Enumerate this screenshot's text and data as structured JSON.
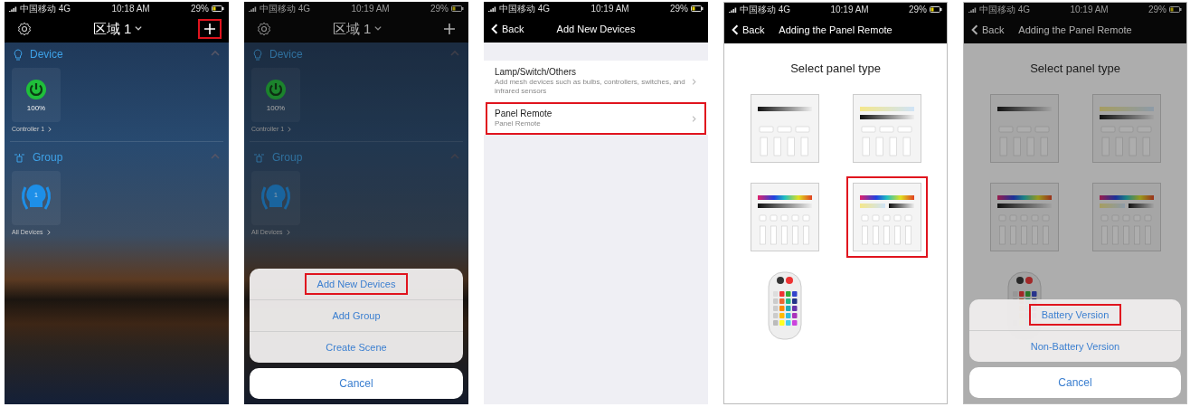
{
  "screens": [
    {
      "kind": "home",
      "status_bar": {
        "carrier": "中国移动 4G",
        "time": "10:18 AM",
        "battery": "29%"
      },
      "title": "区域 1",
      "add_highlighted": true,
      "sections": [
        {
          "kind": "device",
          "label": "Device",
          "expanded": true,
          "tiles": [
            {
              "kind": "power",
              "reading": "100%",
              "label": "Controller 1"
            }
          ]
        },
        {
          "kind": "group",
          "label": "Group",
          "expanded": true,
          "tiles": [
            {
              "kind": "bulb",
              "badge": "1",
              "label": "All Devices"
            }
          ]
        }
      ]
    },
    {
      "kind": "home",
      "status_bar": {
        "carrier": "中国移动 4G",
        "time": "10:19 AM",
        "battery": "29%"
      },
      "title": "区域 1",
      "add_highlighted": false,
      "sections": [
        {
          "kind": "device",
          "label": "Device",
          "expanded": true,
          "tiles": [
            {
              "kind": "power",
              "reading": "100%",
              "label": "Controller 1"
            }
          ]
        },
        {
          "kind": "group",
          "label": "Group",
          "expanded": true,
          "tiles": [
            {
              "kind": "bulb",
              "badge": "1",
              "label": "All Devices"
            }
          ]
        }
      ],
      "action_sheet": {
        "options": [
          {
            "label": "Add New Devices",
            "highlighted": true
          },
          {
            "label": "Add Group",
            "highlighted": false
          },
          {
            "label": "Create Scene",
            "highlighted": false
          }
        ],
        "cancel": "Cancel"
      }
    },
    {
      "kind": "list",
      "status_bar": {
        "carrier": "中国移动 4G",
        "time": "10:19 AM",
        "battery": "29%"
      },
      "nav": {
        "back": "Back",
        "title": "Add New Devices"
      },
      "items": [
        {
          "title": "Lamp/Switch/Others",
          "subtitle": "Add mesh devices such as bulbs, controllers, switches, and infrared sensors",
          "highlighted": false
        },
        {
          "title": "Panel Remote",
          "subtitle": "Panel Remote",
          "highlighted": true
        }
      ]
    },
    {
      "kind": "panel_select",
      "status_bar": {
        "carrier": "中国移动 4G",
        "time": "10:19 AM",
        "battery": "29%"
      },
      "nav": {
        "back": "Back",
        "title": "Adding the Panel Remote"
      },
      "heading": "Select panel type",
      "panels": [
        {
          "kind": "dim",
          "highlighted": false
        },
        {
          "kind": "cct",
          "highlighted": false
        },
        {
          "kind": "rgb",
          "highlighted": false
        },
        {
          "kind": "rgbw",
          "highlighted": true
        },
        {
          "kind": "remote",
          "highlighted": false
        }
      ]
    },
    {
      "kind": "panel_select",
      "status_bar": {
        "carrier": "中国移动 4G",
        "time": "10:19 AM",
        "battery": "29%"
      },
      "nav": {
        "back": "Back",
        "title": "Adding the Panel Remote"
      },
      "heading": "Select panel type",
      "panels": [
        {
          "kind": "dim",
          "highlighted": false
        },
        {
          "kind": "cct",
          "highlighted": false
        },
        {
          "kind": "rgb",
          "highlighted": false
        },
        {
          "kind": "rgbw",
          "highlighted": false
        },
        {
          "kind": "remote",
          "highlighted": false
        }
      ],
      "action_sheet": {
        "options": [
          {
            "label": "Battery Version",
            "highlighted": true
          },
          {
            "label": "Non-Battery Version",
            "highlighted": false
          }
        ],
        "cancel": "Cancel"
      }
    }
  ]
}
